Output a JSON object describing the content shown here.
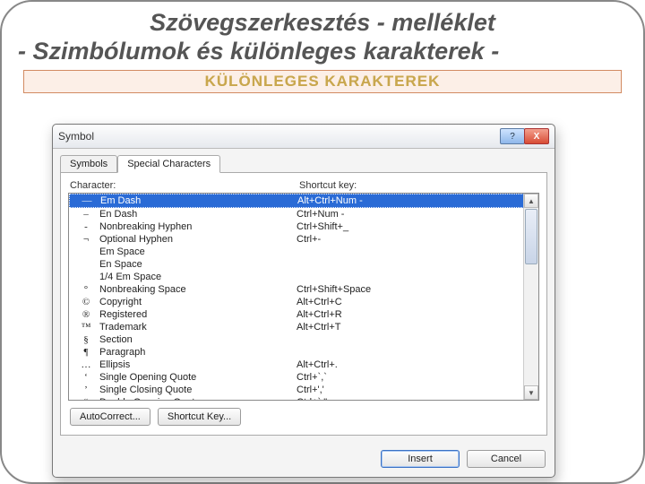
{
  "slide": {
    "title_line1": "Szövegszerkesztés - melléklet",
    "title_line2": "- Szimbólumok és különleges karakterek -",
    "banner": "KÜLÖNLEGES KARAKTEREK"
  },
  "dialog": {
    "title": "Symbol",
    "help": "?",
    "close": "X",
    "tabs": {
      "symbols": "Symbols",
      "special": "Special Characters"
    },
    "columns": {
      "character": "Character:",
      "shortcut": "Shortcut key:"
    },
    "rows": [
      {
        "char": "—",
        "name": "Em Dash",
        "shortcut": "Alt+Ctrl+Num -",
        "selected": true
      },
      {
        "char": "–",
        "name": "En Dash",
        "shortcut": "Ctrl+Num -"
      },
      {
        "char": "-",
        "name": "Nonbreaking Hyphen",
        "shortcut": "Ctrl+Shift+_"
      },
      {
        "char": "¬",
        "name": "Optional Hyphen",
        "shortcut": "Ctrl+-"
      },
      {
        "char": "",
        "name": "Em Space",
        "shortcut": ""
      },
      {
        "char": "",
        "name": "En Space",
        "shortcut": ""
      },
      {
        "char": "",
        "name": "1/4 Em Space",
        "shortcut": ""
      },
      {
        "char": "°",
        "name": "Nonbreaking Space",
        "shortcut": "Ctrl+Shift+Space"
      },
      {
        "char": "©",
        "name": "Copyright",
        "shortcut": "Alt+Ctrl+C"
      },
      {
        "char": "®",
        "name": "Registered",
        "shortcut": "Alt+Ctrl+R"
      },
      {
        "char": "™",
        "name": "Trademark",
        "shortcut": "Alt+Ctrl+T"
      },
      {
        "char": "§",
        "name": "Section",
        "shortcut": ""
      },
      {
        "char": "¶",
        "name": "Paragraph",
        "shortcut": ""
      },
      {
        "char": "…",
        "name": "Ellipsis",
        "shortcut": "Alt+Ctrl+."
      },
      {
        "char": "‘",
        "name": "Single Opening Quote",
        "shortcut": "Ctrl+`,`"
      },
      {
        "char": "’",
        "name": "Single Closing Quote",
        "shortcut": "Ctrl+','"
      },
      {
        "char": "“",
        "name": "Double Opening Quote",
        "shortcut": "Ctrl+`,\""
      }
    ],
    "buttons": {
      "autocorrect": "AutoCorrect...",
      "shortcutkey": "Shortcut Key...",
      "insert": "Insert",
      "cancel": "Cancel"
    }
  }
}
